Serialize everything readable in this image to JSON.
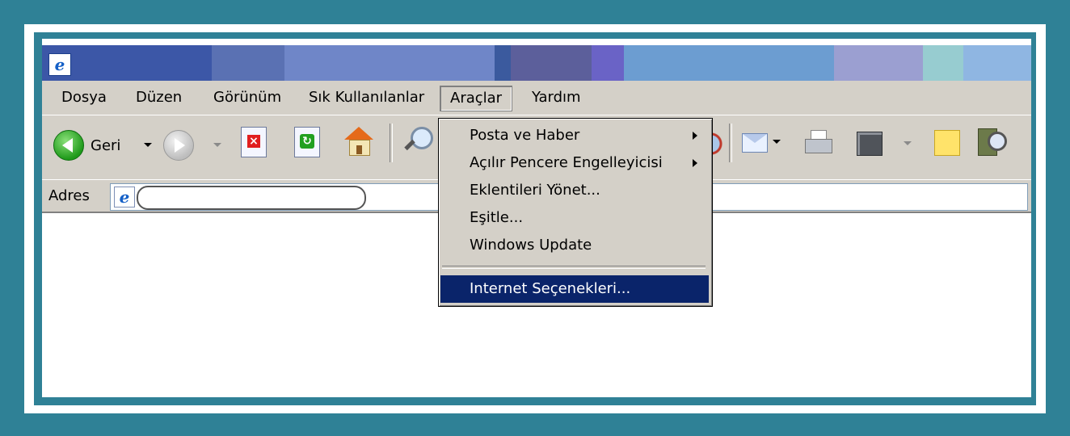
{
  "colors": {
    "frame_teal": "#2f8196",
    "menu_gray": "#d4d0c8",
    "highlight_navy": "#0a246a"
  },
  "menubar": {
    "items": [
      "Dosya",
      "Düzen",
      "Görünüm",
      "Sık Kullanılanlar",
      "Araçlar",
      "Yardım"
    ],
    "open_item": "Araçlar"
  },
  "toolbar": {
    "back_label": "Geri",
    "icons": [
      "back-icon",
      "forward-icon",
      "stop-icon",
      "refresh-icon",
      "home-icon",
      "search-icon",
      "mail-icon",
      "print-icon",
      "edit-icon",
      "messenger-icon",
      "research-icon"
    ]
  },
  "address": {
    "label": "Adres",
    "value": ""
  },
  "dropdown": {
    "items": [
      {
        "label": "Posta ve Haber",
        "submenu": true
      },
      {
        "label": "Açılır Pencere Engelleyicisi",
        "submenu": true
      },
      {
        "label": "Eklentileri Yönet...",
        "submenu": false
      },
      {
        "label": "Eşitle...",
        "submenu": false
      },
      {
        "label": "Windows Update",
        "submenu": false
      },
      {
        "label": "Internet Seçenekleri...",
        "submenu": false,
        "highlighted": true
      }
    ]
  }
}
